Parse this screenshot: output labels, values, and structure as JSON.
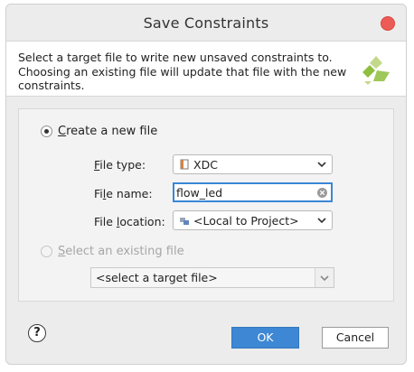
{
  "window": {
    "title": "Save Constraints"
  },
  "description": {
    "line1": "Select a target file to write new unsaved constraints to.",
    "line2": "Choosing an existing file will update that file with the new",
    "line3": "constraints."
  },
  "create_new": {
    "label_mnemonic": "C",
    "label_rest": "reate a new file",
    "checked": true,
    "file_type": {
      "label_mnemonic": "F",
      "label_rest": "ile type:",
      "value": "XDC"
    },
    "file_name": {
      "label_pre": "Fi",
      "label_mnemonic": "l",
      "label_rest": "e name:",
      "value": "flow_led"
    },
    "file_location": {
      "label_pre": "File ",
      "label_mnemonic": "l",
      "label_rest": "ocation:",
      "value": "<Local to Project>"
    }
  },
  "select_existing": {
    "label_mnemonic": "S",
    "label_rest": "elect an existing file",
    "checked": false,
    "enabled": false,
    "dropdown_value": "<select a target file>"
  },
  "buttons": {
    "help": "?",
    "ok": "OK",
    "cancel": "Cancel"
  },
  "colors": {
    "primary": "#3d87d4",
    "close": "#ec5b55",
    "focus": "#3a87d6",
    "logo_green": "#8fbf3f"
  },
  "icons": [
    "close-icon",
    "vivado-logo-icon",
    "xdc-file-icon",
    "clear-icon",
    "folder-location-icon",
    "chevron-down-icon",
    "help-icon"
  ]
}
